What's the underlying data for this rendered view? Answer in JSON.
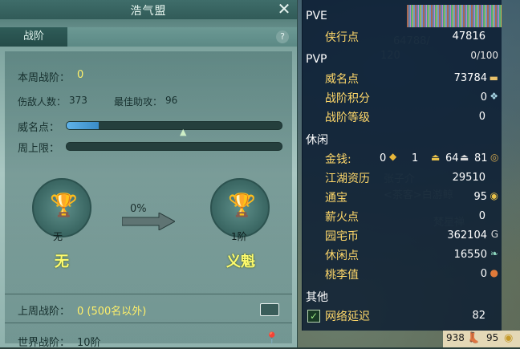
{
  "window": {
    "title": "浩气盟"
  },
  "tabs": [
    {
      "label": "战阶"
    }
  ],
  "help_glyph": "?",
  "stats": {
    "weekly_rank_label": "本周战阶：",
    "weekly_rank_value": "0",
    "kills_label": "伤敌人数：",
    "kills_value": "373",
    "assists_label": "最佳助攻：",
    "assists_value": "96",
    "prestige_label": "威名点：",
    "prestige_progress": 0.15,
    "weekly_cap_label": "周上限：",
    "weekly_cap_progress": 0
  },
  "progress": {
    "current_rank": {
      "small": "无",
      "big": "无"
    },
    "percent": "0%",
    "next_rank": {
      "small": "1阶",
      "big": "义魁"
    }
  },
  "last_week": {
    "label": "上周战阶：",
    "value": "0 (500名以外)"
  },
  "world_rank": {
    "label": "世界战阶：",
    "value": "10阶"
  },
  "scene_labels": [
    "张子介",
    "<茶客>白游鲸",
    "梵星禅",
    "江湖游刃",
    "无懈",
    "桃花绯",
    "64788/",
    "120"
  ],
  "rpanel": {
    "pve": {
      "title": "PVE",
      "items": [
        {
          "label": "侠行点",
          "value": "47816"
        }
      ]
    },
    "pvp": {
      "title": "PVP",
      "items": [
        {
          "label": "威名点",
          "value": "73784"
        },
        {
          "label": "战阶积分",
          "value": "0"
        },
        {
          "label": "战阶等级",
          "value": "0"
        }
      ]
    },
    "leisure": {
      "title": "休闲",
      "money_label": "金钱:",
      "money_gold": "0",
      "money_silver": "1",
      "money_copper": "64",
      "money_iron": "81",
      "items": [
        {
          "label": "江湖资历",
          "value": "29510"
        },
        {
          "label": "通宝",
          "value": "95"
        },
        {
          "label": "薪火点",
          "value": "0"
        },
        {
          "label": "园宅币",
          "value": "362104"
        },
        {
          "label": "休闲点",
          "value": "16550"
        },
        {
          "label": "桃李值",
          "value": "0"
        }
      ]
    },
    "other": {
      "title": "其他",
      "items": [
        {
          "label": "网络延迟",
          "value": "82"
        }
      ]
    },
    "partial_progress": "0/100"
  },
  "footer": {
    "a": "938",
    "b": "95"
  },
  "colors": {
    "accent": "#fff06a",
    "gold_label": "#ffd86a",
    "bar_fill": "#3a8cc7"
  }
}
